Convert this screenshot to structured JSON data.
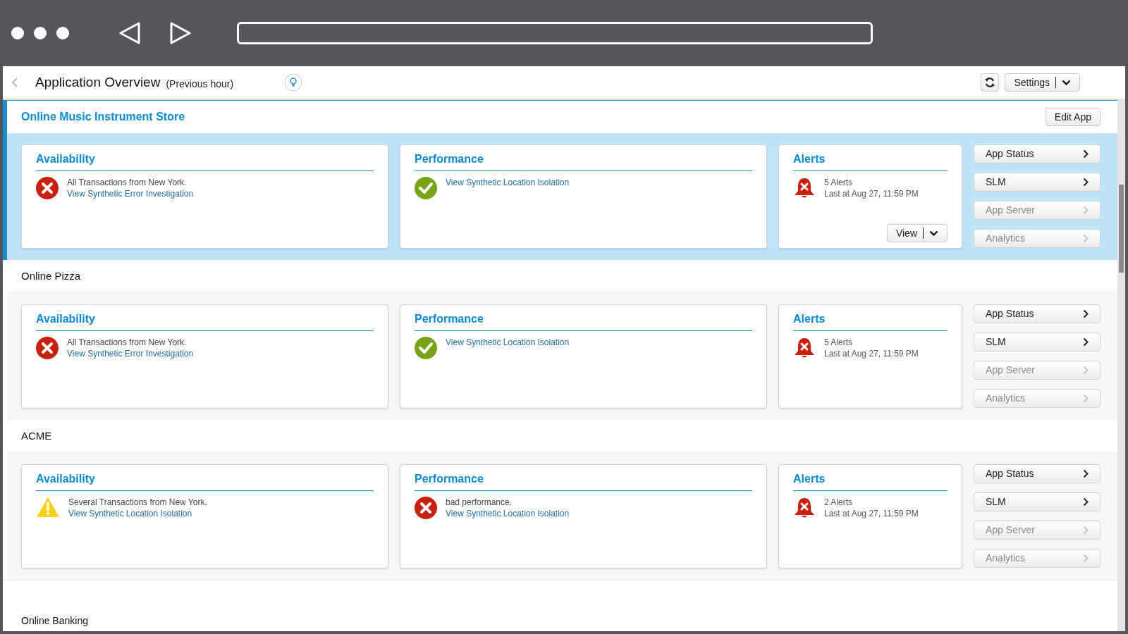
{
  "page": {
    "title": "Application Overview",
    "period": "(Previous hour)",
    "settings_button": "Settings"
  },
  "apps": [
    {
      "name": "Online Music Instrument Store",
      "selected": true,
      "edit_button": "Edit App",
      "availability": {
        "title": "Availability",
        "kind": "error",
        "message": "All Transactions from New York.",
        "link": "View Synthetic Error Investigation"
      },
      "performance": {
        "title": "Performance",
        "kind": "ok",
        "link": "View Synthetic Location Isolation"
      },
      "alerts": {
        "title": "Alerts",
        "count": "5 Alerts",
        "last": "Last at Aug 27, 11:59 PM",
        "view_button": "View"
      },
      "nav": [
        {
          "label": "App Status",
          "disabled": false
        },
        {
          "label": "SLM",
          "disabled": false
        },
        {
          "label": "App Server",
          "disabled": true
        },
        {
          "label": "Analytics",
          "disabled": true
        }
      ]
    },
    {
      "name": "Online Pizza",
      "selected": false,
      "availability": {
        "title": "Availability",
        "kind": "error",
        "message": "All Transactions from New York.",
        "link": "View Synthetic Error Investigation"
      },
      "performance": {
        "title": "Performance",
        "kind": "ok",
        "link": "View Synthetic Location Isolation"
      },
      "alerts": {
        "title": "Alerts",
        "count": "5 Alerts",
        "last": "Last at Aug 27, 11:59 PM"
      },
      "nav": [
        {
          "label": "App Status",
          "disabled": false
        },
        {
          "label": "SLM",
          "disabled": false
        },
        {
          "label": "App Server",
          "disabled": true
        },
        {
          "label": "Analytics",
          "disabled": true
        }
      ]
    },
    {
      "name": "ACME",
      "selected": false,
      "availability": {
        "title": "Availability",
        "kind": "warning",
        "message": "Several Transactions from New York.",
        "link": "View Synthetic Location Isolation"
      },
      "performance": {
        "title": "Performance",
        "kind": "error",
        "message": "bad performance.",
        "link": "View Synthetic Location Isolation"
      },
      "alerts": {
        "title": "Alerts",
        "count": "2 Alerts",
        "last": "Last at Aug 27, 11:59 PM"
      },
      "nav": [
        {
          "label": "App Status",
          "disabled": false
        },
        {
          "label": "SLM",
          "disabled": false
        },
        {
          "label": "App Server",
          "disabled": true
        },
        {
          "label": "Analytics",
          "disabled": true
        }
      ]
    }
  ],
  "next_app": {
    "name": "Online Banking"
  }
}
